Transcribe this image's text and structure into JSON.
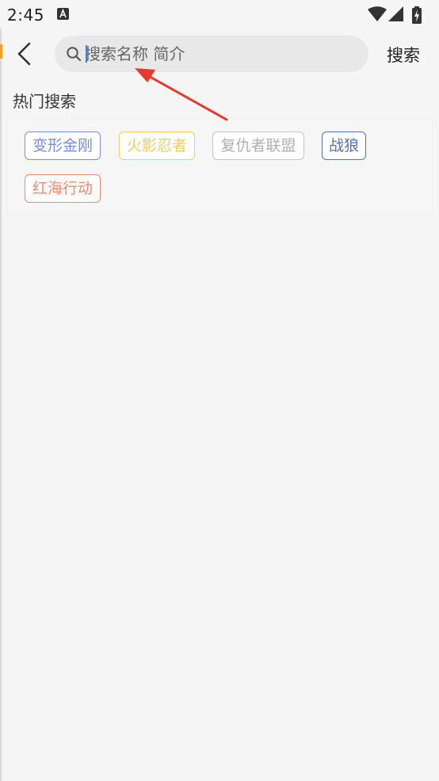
{
  "status_bar": {
    "time": "2:45",
    "notification_icon": "a-letter-icon",
    "wifi_icon": "wifi-icon",
    "signal_icon": "signal-icon",
    "battery_icon": "battery-charging-icon"
  },
  "header": {
    "back_icon": "chevron-left-icon",
    "search_icon": "search-icon",
    "search_placeholder": "搜索名称 简介",
    "search_value": "",
    "search_button_label": "搜索"
  },
  "hot_search": {
    "title": "热门搜索",
    "tags": [
      {
        "label": "变形金刚",
        "color": "#7b8fd4"
      },
      {
        "label": "火影忍者",
        "color": "#f2cf5b"
      },
      {
        "label": "复仇者联盟",
        "color": "#b8b8b8"
      },
      {
        "label": "战狼",
        "color": "#5a6fb8"
      },
      {
        "label": "红海行动",
        "color": "#f08a6c"
      }
    ]
  },
  "colors": {
    "background": "#f5f5f5",
    "search_box": "#e8e8e8",
    "cursor": "#3b7fe0",
    "annotation_arrow": "#e8382e"
  }
}
